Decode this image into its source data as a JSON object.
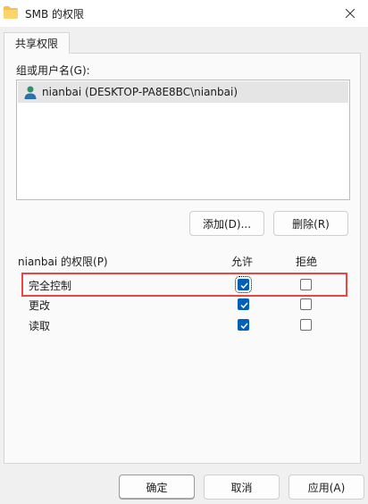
{
  "window": {
    "title": "SMB 的权限"
  },
  "tabs": [
    {
      "label": "共享权限"
    }
  ],
  "group": {
    "label": "组或用户名(G):",
    "users": [
      {
        "name": "nianbai (DESKTOP-PA8E8BC\\nianbai)"
      }
    ],
    "add_button": "添加(D)...",
    "remove_button": "删除(R)"
  },
  "permissions": {
    "title": "nianbai 的权限(P)",
    "allow_header": "允许",
    "deny_header": "拒绝",
    "rows": [
      {
        "label": "完全控制",
        "allow": true,
        "deny": false
      },
      {
        "label": "更改",
        "allow": true,
        "deny": false
      },
      {
        "label": "读取",
        "allow": true,
        "deny": false
      }
    ]
  },
  "footer": {
    "ok": "确定",
    "cancel": "取消",
    "apply": "应用(A)"
  },
  "colors": {
    "accent": "#005fb8",
    "highlight": "#e84545"
  }
}
